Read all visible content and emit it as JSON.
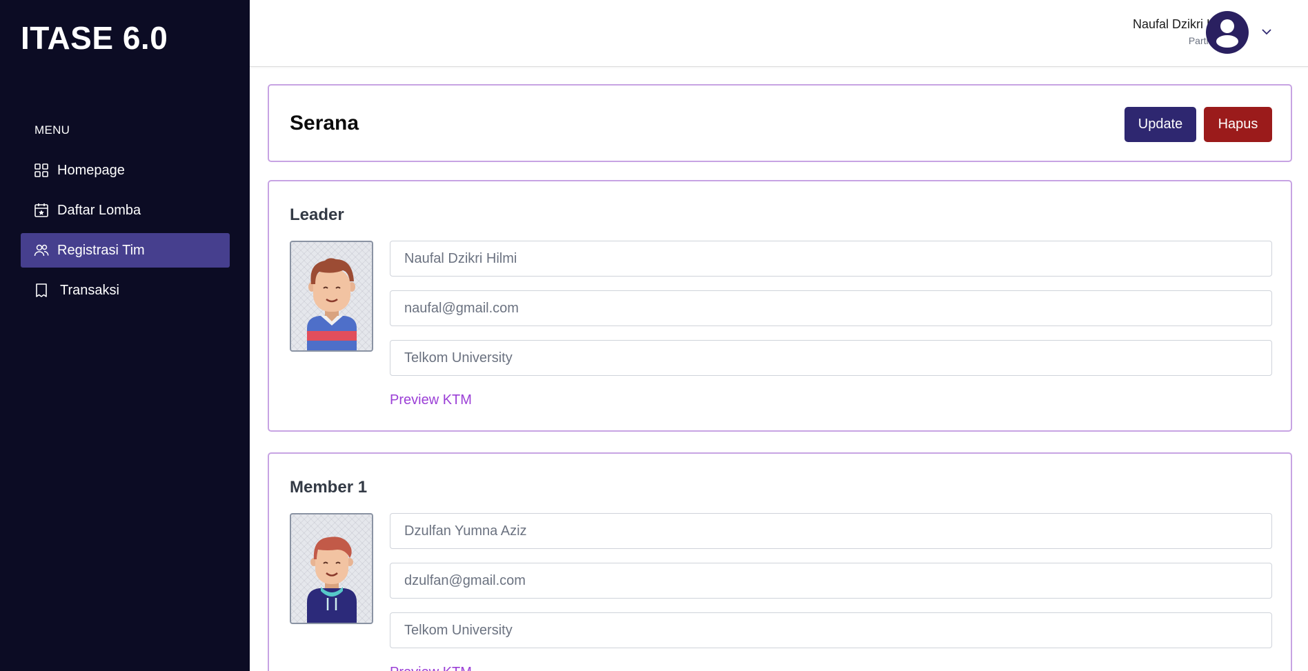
{
  "sidebar": {
    "brand": "ITASE 6.0",
    "menu_heading": "MENU",
    "items": [
      {
        "label": "Homepage",
        "icon": "grid-icon",
        "active": false
      },
      {
        "label": "Daftar Lomba",
        "icon": "calendar-star-icon",
        "active": false
      },
      {
        "label": "Registrasi Tim",
        "icon": "users-icon",
        "active": true
      },
      {
        "label": "Transaksi",
        "icon": "receipt-icon",
        "active": false
      }
    ]
  },
  "header": {
    "user_name": "Naufal Dzikri Hilmi",
    "user_role": "Participant",
    "avatar_icon": "user-avatar-icon",
    "dropdown_icon": "chevron-down-icon"
  },
  "team": {
    "name": "Serana",
    "update_label": "Update",
    "delete_label": "Hapus"
  },
  "leader": {
    "section_title": "Leader",
    "name": "Naufal Dzikri Hilmi",
    "email": "naufal@gmail.com",
    "university": "Telkom University",
    "preview_label": "Preview KTM"
  },
  "member1": {
    "section_title": "Member 1",
    "name": "Dzulfan Yumna Aziz",
    "email": "dzulfan@gmail.com",
    "university": "Telkom University",
    "preview_label": "Preview KTM"
  },
  "colors": {
    "sidebar_bg": "#0c0c24",
    "active_item": "#463f8e",
    "update_button": "#2e2770",
    "delete_button": "#9b1b1b",
    "card_border": "#c7a3e3",
    "link": "#9b3fd6"
  }
}
